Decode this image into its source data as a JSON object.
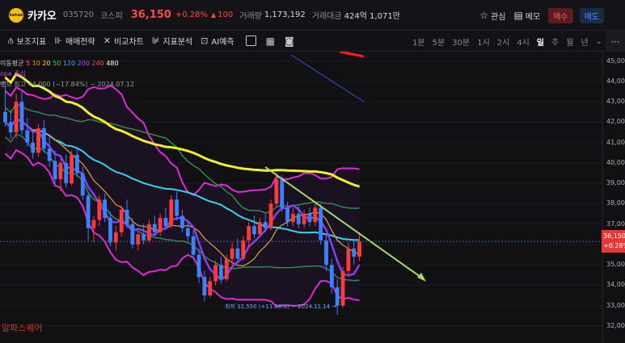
{
  "header": {
    "logo_text": "kakao",
    "name": "카카오",
    "code": "035720",
    "market": "코스피",
    "price": "36,150",
    "change_pct": "+0.28%",
    "change_arrow": "▲",
    "change_abs": "100",
    "volume_label": "거래량",
    "volume": "1,173,192",
    "value_label": "거래대금",
    "value": "424억 1,071만",
    "watch_label": "관심",
    "memo_label": "메모",
    "buy_label": "매수",
    "sell_label": "매도"
  },
  "toolbar": {
    "aux_indicator": "보조지표",
    "trade_strategy": "매매전략",
    "compare_chart": "비교차트",
    "indicator_analysis": "지표분석",
    "ai_prediction": "AI예측",
    "periods": [
      "1분",
      "5분",
      "30분",
      "1시",
      "2시",
      "4시",
      "일",
      "주",
      "월",
      "년"
    ],
    "active_period": "일",
    "dropdown": "⌄"
  },
  "legend": {
    "ma_label": "이동평균",
    "ma_periods": [
      "5",
      "10",
      "20",
      "50",
      "120",
      "200",
      "240",
      "480"
    ],
    "envelope_label": "ope 중심",
    "bands_label": "밴드",
    "high_note": "최고 44,000 (−17.84%) − 2024.07.12",
    "low_note": "최저 32,550 (+11.06%) − 2024.11.14 →"
  },
  "watermark": "알파스퀘어",
  "y_axis": {
    "ticks": [
      "45,000",
      "44,000",
      "43,000",
      "42,000",
      "41,000",
      "40,000",
      "39,000",
      "38,000",
      "37,000",
      "36,000",
      "35,000",
      "34,000",
      "33,000",
      "32,000"
    ],
    "current_price": "36,150",
    "current_pct": "+0.28%"
  },
  "chart_data": {
    "type": "candlestick",
    "ylim": [
      31800,
      45300
    ],
    "current_price": 36150,
    "ma_colors": {
      "5": "#ff6a6a",
      "10": "#ff8c1a",
      "20": "#f5e042",
      "50": "#41c86a",
      "120": "#4aa3ff",
      "200": "#b14cff",
      "240": "#ff4a4a",
      "480": "#ffffff"
    },
    "colors": {
      "up": "#ff3b3b",
      "down": "#3b82ff"
    },
    "candles": [
      [
        42500,
        43800,
        41800,
        42000
      ],
      [
        42000,
        42600,
        41200,
        41500
      ],
      [
        41500,
        43400,
        41200,
        43000
      ],
      [
        43000,
        43500,
        41400,
        41600
      ],
      [
        41600,
        42200,
        40800,
        41000
      ],
      [
        41000,
        41600,
        40200,
        40500
      ],
      [
        40500,
        41900,
        40300,
        41700
      ],
      [
        41700,
        42100,
        40500,
        40700
      ],
      [
        40700,
        41300,
        39800,
        40100
      ],
      [
        40100,
        40600,
        38900,
        39200
      ],
      [
        39200,
        40200,
        38600,
        40000
      ],
      [
        40000,
        40400,
        38800,
        39000
      ],
      [
        39000,
        40600,
        38900,
        40400
      ],
      [
        40400,
        40700,
        39300,
        39500
      ],
      [
        39500,
        39800,
        38200,
        38400
      ],
      [
        38400,
        38600,
        36200,
        36800
      ],
      [
        36800,
        37400,
        36100,
        37200
      ],
      [
        37200,
        38400,
        36900,
        38200
      ],
      [
        38200,
        38500,
        37100,
        37300
      ],
      [
        37300,
        37600,
        35900,
        36100
      ],
      [
        36100,
        36900,
        35700,
        36600
      ],
      [
        36600,
        37900,
        36400,
        37700
      ],
      [
        37700,
        38200,
        36800,
        37000
      ],
      [
        37000,
        37300,
        35800,
        36000
      ],
      [
        36000,
        36600,
        35700,
        36500
      ],
      [
        36500,
        37000,
        36000,
        36200
      ],
      [
        36200,
        37200,
        36100,
        37000
      ],
      [
        37000,
        37400,
        36400,
        36600
      ],
      [
        36600,
        37500,
        36400,
        37300
      ],
      [
        37300,
        37800,
        36700,
        36900
      ],
      [
        36900,
        38400,
        36800,
        38200
      ],
      [
        38200,
        38600,
        37200,
        37400
      ],
      [
        37400,
        37700,
        36600,
        36800
      ],
      [
        36800,
        37100,
        36200,
        36400
      ],
      [
        36400,
        36700,
        35300,
        35500
      ],
      [
        35500,
        35800,
        34100,
        34400
      ],
      [
        34400,
        34700,
        33200,
        33500
      ],
      [
        33500,
        34400,
        33400,
        34200
      ],
      [
        34200,
        35200,
        34000,
        35000
      ],
      [
        35000,
        35400,
        34100,
        34300
      ],
      [
        34300,
        35500,
        34200,
        35300
      ],
      [
        35300,
        36100,
        35000,
        35800
      ],
      [
        35800,
        36300,
        35100,
        35300
      ],
      [
        35300,
        36400,
        35200,
        36200
      ],
      [
        36200,
        37100,
        35800,
        36900
      ],
      [
        36900,
        37400,
        36300,
        36500
      ],
      [
        36500,
        37300,
        36400,
        37100
      ],
      [
        37100,
        37500,
        36600,
        36800
      ],
      [
        36800,
        38200,
        36700,
        38000
      ],
      [
        38000,
        39500,
        37800,
        39200
      ],
      [
        39200,
        39400,
        37600,
        37800
      ],
      [
        37800,
        38100,
        36900,
        37100
      ],
      [
        37100,
        37800,
        36900,
        37500
      ],
      [
        37500,
        37900,
        36800,
        37000
      ],
      [
        37000,
        37700,
        36800,
        37500
      ],
      [
        37500,
        37800,
        36900,
        37100
      ],
      [
        37100,
        38000,
        36900,
        37800
      ],
      [
        37800,
        38000,
        36000,
        36200
      ],
      [
        36200,
        36500,
        34700,
        35000
      ],
      [
        35000,
        35300,
        33600,
        33900
      ],
      [
        33900,
        34300,
        32550,
        33000
      ],
      [
        33000,
        34900,
        32900,
        34700
      ],
      [
        34700,
        36100,
        34500,
        35800
      ],
      [
        35800,
        36200,
        35000,
        35400
      ],
      [
        35400,
        36600,
        35200,
        36150
      ]
    ],
    "trendline": {
      "start": [
        0.49,
        39800
      ],
      "end": [
        0.785,
        34300
      ]
    }
  }
}
